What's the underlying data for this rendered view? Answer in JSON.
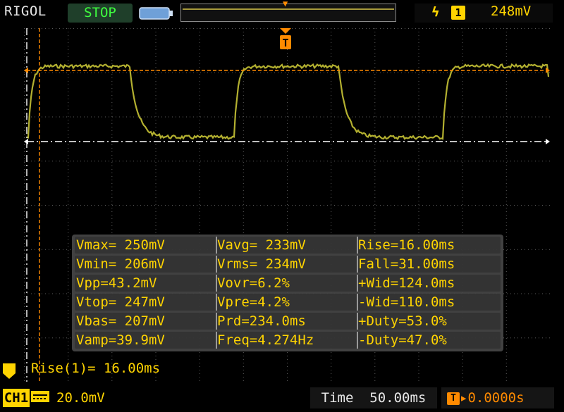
{
  "brand": "RIGOL",
  "run_state": "STOP",
  "trigger": {
    "edge_icon": "rising-edge-icon",
    "channel": "1",
    "level": "248mV"
  },
  "waveform_t_marker": "T",
  "measurements": [
    [
      "Vmax= 250mV",
      "Vavg= 233mV",
      "Rise=16.00ms"
    ],
    [
      "Vmin= 206mV",
      "Vrms= 234mV",
      "Fall=31.00ms"
    ],
    [
      "Vpp=43.2mV",
      "Vovr=6.2%",
      "+Wid=124.0ms"
    ],
    [
      "Vtop= 247mV",
      "Vpre=4.2%",
      "-Wid=110.0ms"
    ],
    [
      "Vbas= 207mV",
      "Prd=234.0ms",
      "+Duty=53.0%"
    ],
    [
      "Vamp=39.9mV",
      "Freq=4.274Hz",
      "-Duty=47.0%"
    ]
  ],
  "rise_readout": "Rise(1)= 16.00ms",
  "bottom": {
    "channel_label": "CH1",
    "channel_scale": "20.0mV",
    "timebase": "Time  50.00ms",
    "trigger_offset": "0.0000s"
  },
  "colors": {
    "trace": "#b3b030",
    "accent": "#ffd400",
    "trigger": "#ff8a00"
  }
}
